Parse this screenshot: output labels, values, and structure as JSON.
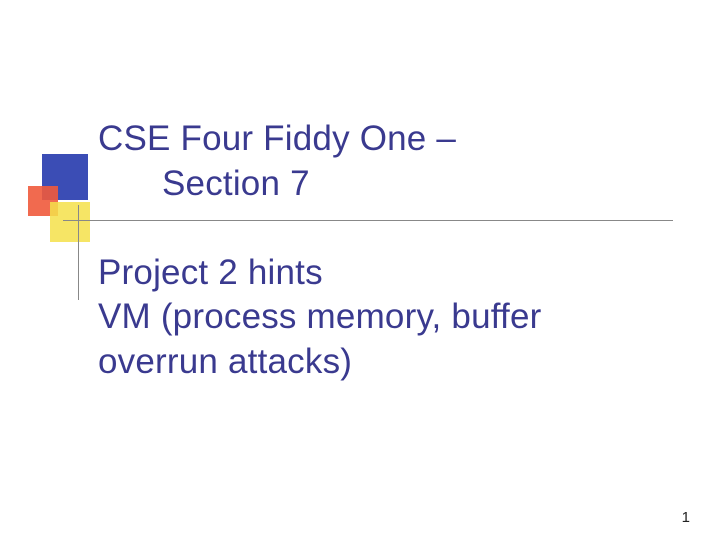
{
  "slide": {
    "title_line1": "CSE Four Fiddy One –",
    "title_line2": "Section 7",
    "subtitle_line1": "Project 2 hints",
    "subtitle_line2": "VM (process memory, buffer",
    "subtitle_line3": "overrun attacks)",
    "page_number": "1"
  },
  "colors": {
    "title_text": "#3a3a8f",
    "square_blue": "#3b4db5",
    "square_red": "#f05a3c",
    "square_yellow": "#f5e04a"
  }
}
